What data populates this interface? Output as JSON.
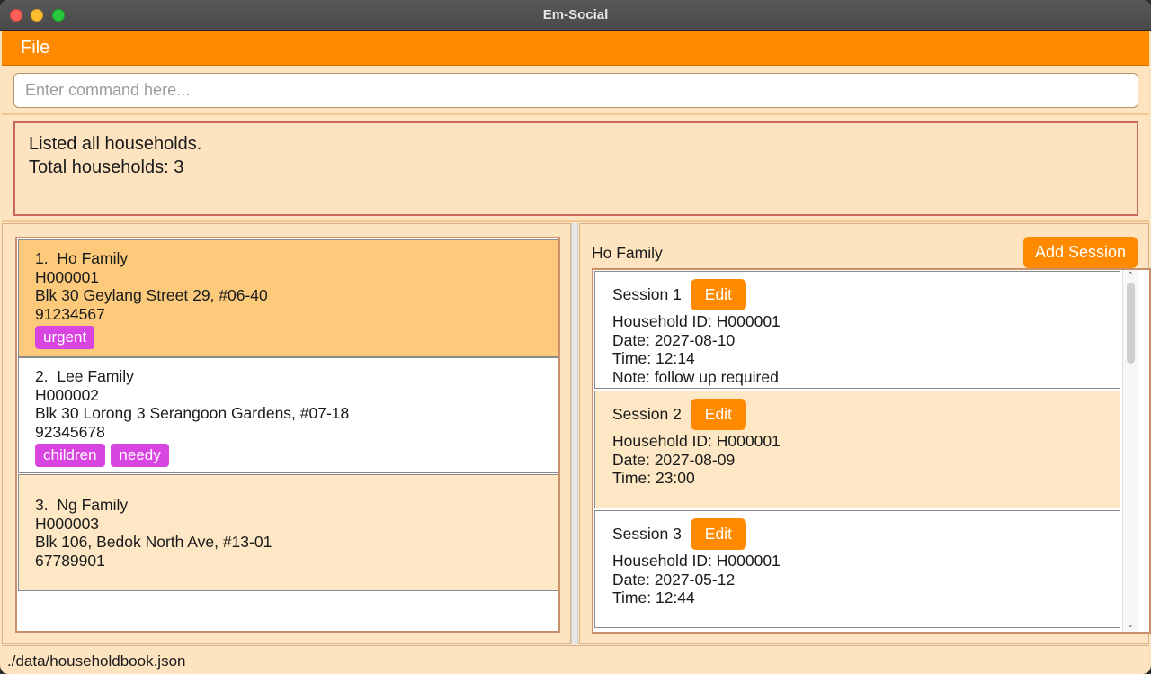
{
  "window": {
    "title": "Em-Social"
  },
  "menu": {
    "file": "File"
  },
  "command": {
    "placeholder": "Enter command here..."
  },
  "result": {
    "lines": [
      "Listed all households.",
      "Total households: 3"
    ]
  },
  "households": [
    {
      "index": "1.",
      "name": "Ho Family",
      "id": "H000001",
      "address": "Blk 30 Geylang Street 29, #06-40",
      "phone": "91234567",
      "tags": [
        "urgent"
      ]
    },
    {
      "index": "2.",
      "name": "Lee Family",
      "id": "H000002",
      "address": "Blk 30 Lorong 3 Serangoon Gardens, #07-18",
      "phone": "92345678",
      "tags": [
        "children",
        "needy"
      ]
    },
    {
      "index": "3.",
      "name": "Ng Family",
      "id": "H000003",
      "address": "Blk 106, Bedok North Ave, #13-01",
      "phone": "67789901",
      "tags": []
    }
  ],
  "session_panel": {
    "household_name": "Ho Family",
    "add_session_label": "Add Session",
    "edit_label": "Edit",
    "sessions": [
      {
        "title": "Session 1",
        "household_id": "Household ID: H000001",
        "date": "Date: 2027-08-10",
        "time": "Time: 12:14",
        "note": "Note: follow up required"
      },
      {
        "title": "Session 2",
        "household_id": "Household ID: H000001",
        "date": "Date: 2027-08-09",
        "time": "Time: 23:00",
        "note": ""
      },
      {
        "title": "Session 3",
        "household_id": "Household ID: H000001",
        "date": "Date: 2027-05-12",
        "time": "Time: 12:44",
        "note": ""
      }
    ]
  },
  "status": {
    "file_path": "./data/householdbook.json"
  },
  "colors": {
    "accent": "#ff8a00",
    "tag": "#d845e0",
    "selected": "#fdc97a",
    "panel_bg": "#fde3bf"
  }
}
